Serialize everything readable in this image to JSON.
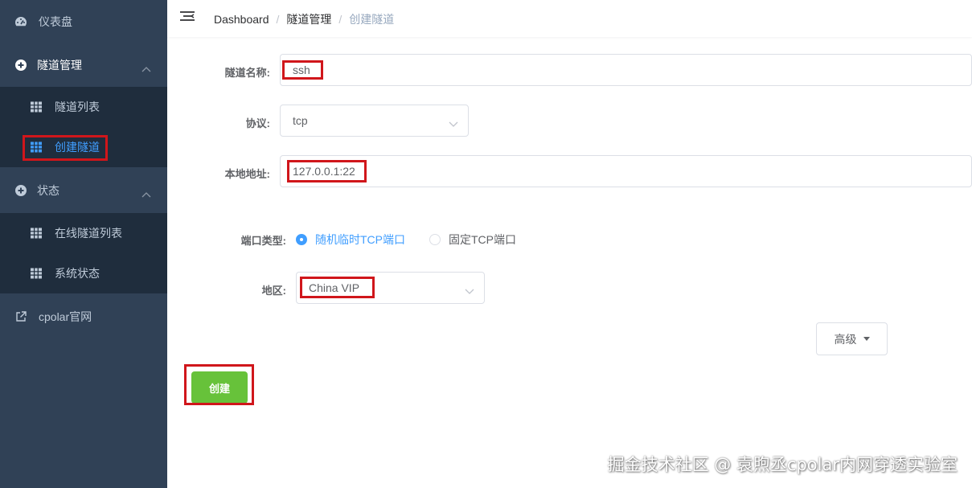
{
  "sidebar": {
    "dashboard_label": "仪表盘",
    "tunnel_mgmt_label": "隧道管理",
    "tunnel_list_label": "隧道列表",
    "create_tunnel_label": "创建隧道",
    "status_label": "状态",
    "online_tunnels_label": "在线隧道列表",
    "system_status_label": "系统状态",
    "cpolar_site_label": "cpolar官网"
  },
  "breadcrumb": {
    "home": "Dashboard",
    "section": "隧道管理",
    "current": "创建隧道",
    "separator": "/"
  },
  "form": {
    "name_label": "隧道名称:",
    "name_value": "ssh",
    "protocol_label": "协议:",
    "protocol_value": "tcp",
    "local_addr_label": "本地地址:",
    "local_addr_value": "127.0.0.1:22",
    "port_type_label": "端口类型:",
    "port_type_options": [
      "随机临时TCP端口",
      "固定TCP端口"
    ],
    "port_type_selected": "随机临时TCP端口",
    "region_label": "地区:",
    "region_value": "China VIP",
    "advanced_label": "高级",
    "create_label": "创建"
  },
  "watermark": "掘金技术社区 @ 袁煦丞cpolar内网穿透实验室",
  "colors": {
    "sidebar_bg": "#304156",
    "submenu_bg": "#1f2d3d",
    "accent": "#409eff",
    "create_button": "#67c23a",
    "highlight_box": "#d0161b"
  }
}
